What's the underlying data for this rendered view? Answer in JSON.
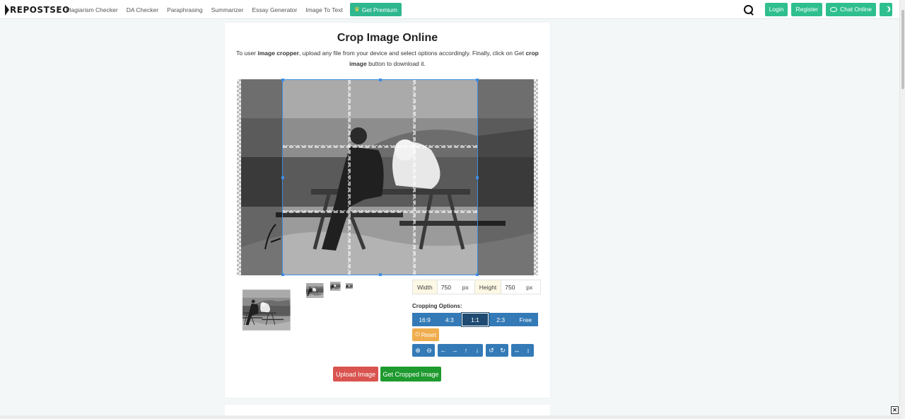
{
  "nav": {
    "logo": "REPOSTSEO",
    "links": [
      "Plagiarism Checker",
      "DA Checker",
      "Paraphrasing",
      "Summarizer",
      "Essay Generator",
      "Image To Text"
    ],
    "premium": "Get Premium",
    "login": "Login",
    "register": "Register",
    "chat": "Chat Online"
  },
  "main": {
    "title": "Crop Image Online",
    "desc_1": "To user ",
    "desc_b1": "image cropper",
    "desc_2": ", upload any file from your device and select options accordingly. Finally, click on Get ",
    "desc_b2": "crop image",
    "desc_3": " button to download it."
  },
  "controls": {
    "width_label": "Width",
    "width_value": "750",
    "height_label": "Height",
    "height_value": "750",
    "unit": "px",
    "cropping_label": "Cropping Options:",
    "ratios": [
      "16:9",
      "4:3",
      "1:1",
      "2:3",
      "Free"
    ],
    "active_ratio": "1:1",
    "reset": "Reset",
    "upload": "Upload Image",
    "get_cropped": "Get Cropped Image"
  },
  "colors": {
    "accent": "#2fbf8f",
    "primary": "#337ab7",
    "danger": "#d9534f",
    "success": "#1e9a2e",
    "warning": "#f0ad4e",
    "crop_border": "#3f8de0"
  },
  "icons": [
    "search-icon",
    "chat-icon",
    "moon-icon",
    "crown-icon",
    "zoom-in-icon",
    "zoom-out-icon",
    "arrow-left-icon",
    "arrow-right-icon",
    "arrow-up-icon",
    "arrow-down-icon",
    "rotate-left-icon",
    "rotate-right-icon",
    "flip-horizontal-icon",
    "flip-vertical-icon",
    "close-icon"
  ]
}
